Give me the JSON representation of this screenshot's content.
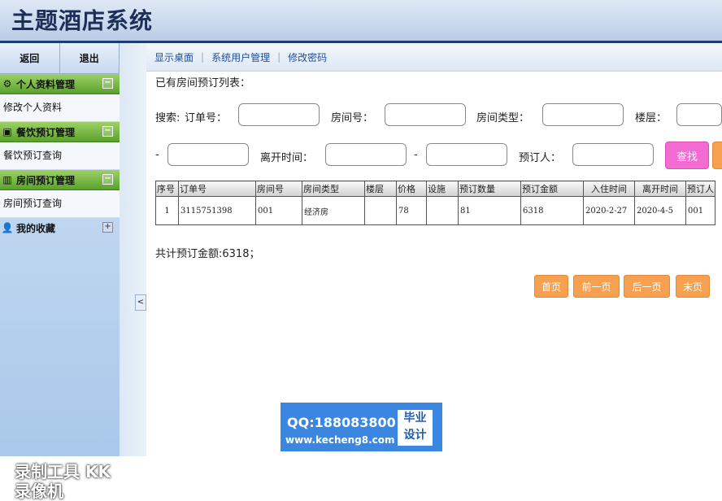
{
  "header": {
    "title": "主题酒店系统"
  },
  "sidebar": {
    "back_label": "返回",
    "logout_label": "退出",
    "groups": [
      {
        "label": "个人资料管理",
        "item": "修改个人资料"
      },
      {
        "label": "餐饮预订管理",
        "item": "餐饮预订查询"
      },
      {
        "label": "房间预订管理",
        "item": "房间预订查询"
      },
      {
        "label": "我的收藏"
      }
    ],
    "collapse_glyph": "<",
    "watermark": "录制工具 KK录像机"
  },
  "topnav": {
    "links": [
      "显示桌面",
      "系统用户管理",
      "修改密码"
    ]
  },
  "main": {
    "list_title": "已有房间预订列表：",
    "search": {
      "prefix": "搜索:",
      "order_no": "订单号：",
      "room_no": "房间号：",
      "room_type": "房间类型：",
      "floor": "楼层：",
      "range_dash": "-",
      "leave_time": "离开时间：",
      "booker": "预订人：",
      "search_button": "查找"
    },
    "table": {
      "headers": [
        "序号",
        "订单号",
        "房间号",
        "房间类型",
        "楼层",
        "价格",
        "设施",
        "预订数量",
        "预订金额",
        "入住时间",
        "离开时间",
        "预订人"
      ],
      "rows": [
        [
          "1",
          "3115751398",
          "001",
          "经济房",
          "",
          "78",
          "",
          "81",
          "6318",
          "2020-2-27",
          "2020-4-5",
          "001"
        ]
      ]
    },
    "total": "共计预订金额:6318；",
    "pager": [
      "首页",
      "前一页",
      "后一页",
      "末页"
    ]
  },
  "overlay": {
    "qq": "QQ:188083800",
    "site": "www.kecheng8.com",
    "badge_line1": "毕业",
    "badge_line2": "设计"
  },
  "colors": {
    "accent_green": "#5aa22c",
    "search_button": "#f26bd2",
    "pager_button": "#f7a050",
    "header_border": "#1f3c6e"
  }
}
